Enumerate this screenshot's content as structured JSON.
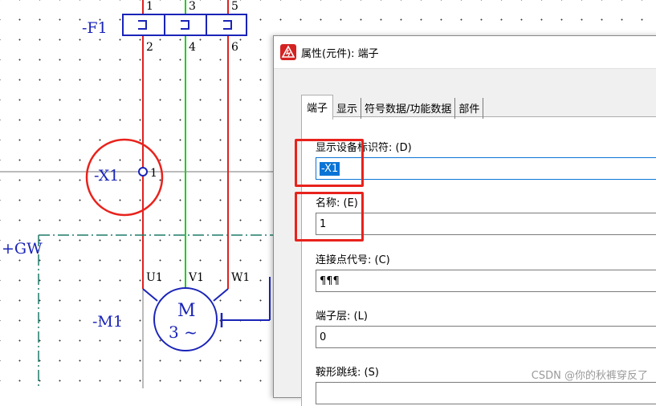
{
  "schematic": {
    "fuse_label": "-F1",
    "fuse_pins_top": [
      "1",
      "3",
      "5"
    ],
    "fuse_pins_bottom": [
      "2",
      "4",
      "6"
    ],
    "terminal_label": "-X1",
    "terminal_pin": "1",
    "location_label": "+GW",
    "motor_label": "-M1",
    "motor_symbol": "M",
    "motor_phase": "3 ~",
    "motor_pins": [
      "U1",
      "V1",
      "W1"
    ],
    "wire_colors": {
      "red": "#e02020",
      "green": "#22cc22",
      "blue": "#1a24b8"
    }
  },
  "dialog": {
    "title": "属性(元件): 端子",
    "tabs": [
      "端子",
      "显示",
      "符号数据/功能数据",
      "部件"
    ],
    "active_tab": "端子",
    "fields": {
      "device_tag": {
        "label": "显示设备标识符: (D)",
        "value": "-X1"
      },
      "name": {
        "label": "名称: (E)",
        "value": "1"
      },
      "connection_point": {
        "label": "连接点代号: (C)",
        "value": "¶¶¶"
      },
      "terminal_level": {
        "label": "端子层: (L)",
        "value": "0"
      },
      "saddle_jumper": {
        "label": "鞍形跳线: (S)",
        "value": ""
      }
    }
  },
  "watermark": "CSDN @你的秋裤穿反了"
}
